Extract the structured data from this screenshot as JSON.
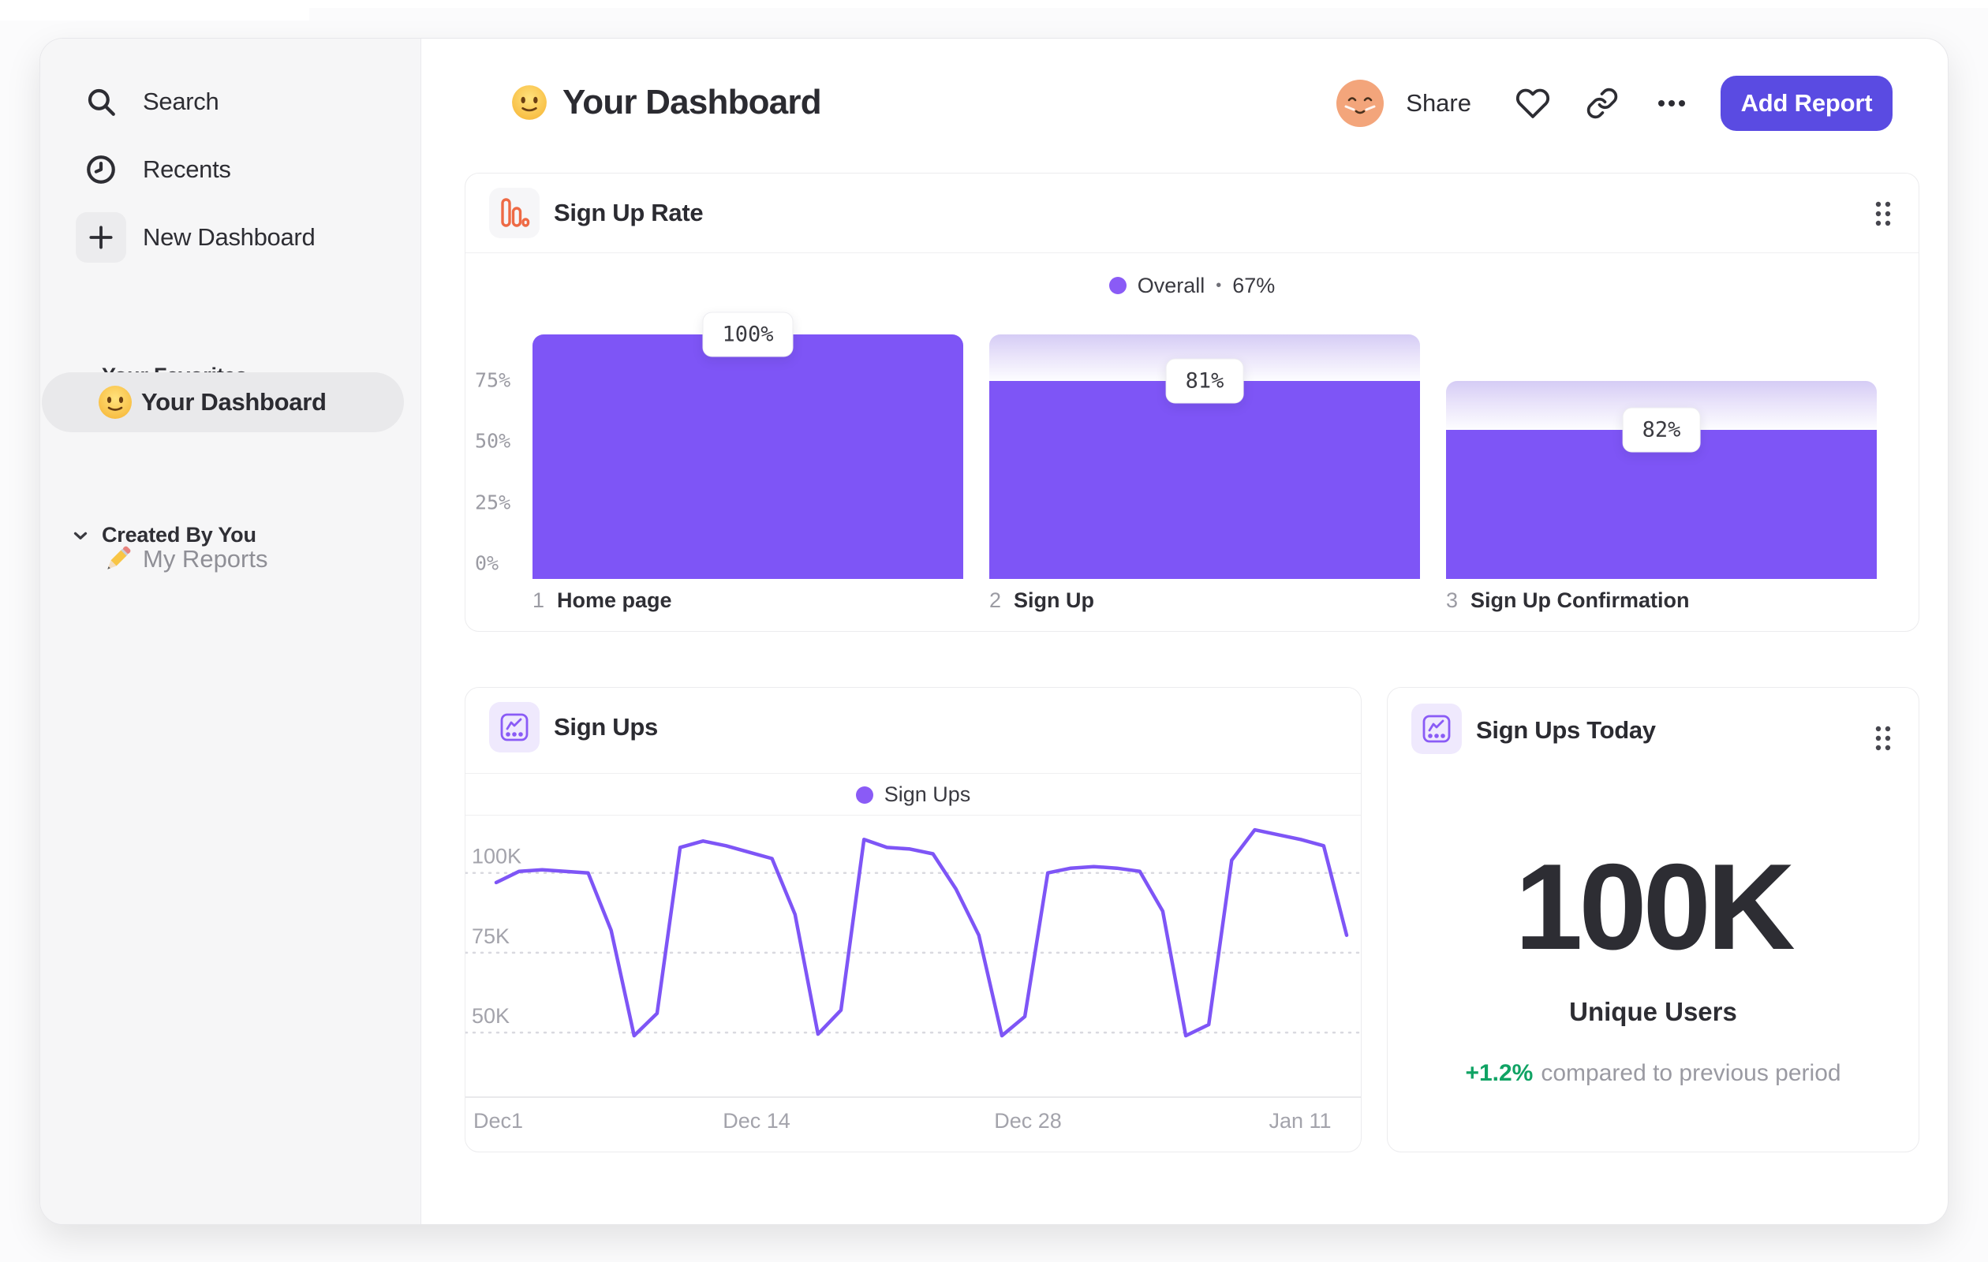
{
  "theme": {
    "accent_purple": "#7e55f6",
    "legend_purple": "#8a5bf6",
    "button_indigo": "#5a4be2",
    "icon_orange": "#ee6a45",
    "delta_green": "#10a364",
    "sidebar_bg": "#f6f6f7",
    "tick_gray": "#9b9ba3"
  },
  "sidebar": {
    "nav": [
      {
        "icon": "search-icon",
        "label": "Search"
      },
      {
        "icon": "clock-icon",
        "label": "Recents"
      },
      {
        "icon": "plus-icon",
        "label": "New Dashboard"
      }
    ],
    "sections": [
      {
        "label": "Your Favorites",
        "items": [
          {
            "icon": "smiley-emoji",
            "label": "Your Dashboard",
            "selected": true
          }
        ]
      },
      {
        "label": "Created By You",
        "items": [
          {
            "icon": "pencil-emoji",
            "label": "My Reports",
            "selected": false
          }
        ]
      }
    ]
  },
  "header": {
    "title": "Your Dashboard",
    "share": "Share",
    "add_report": "Add Report"
  },
  "funnel_card": {
    "title": "Sign Up Rate",
    "legend_label": "Overall",
    "legend_sep": "•",
    "legend_value": "67%"
  },
  "line_card": {
    "title": "Sign Ups",
    "legend_label": "Sign Ups"
  },
  "metric_card": {
    "title": "Sign Ups Today",
    "value": "100K",
    "label": "Unique Users",
    "delta": "+1.2%",
    "delta_text": "compared to previous period"
  },
  "chart_data": [
    {
      "type": "bar",
      "subtype": "funnel",
      "title": "Sign Up Rate",
      "legend": "Overall • 67%",
      "overall_conversion": "67%",
      "ylim": [
        0,
        100
      ],
      "grid": false,
      "y_ticks": [
        {
          "label": "75%",
          "value": 75
        },
        {
          "label": "50%",
          "value": 50
        },
        {
          "label": "25%",
          "value": 25
        },
        {
          "label": "0%",
          "value": 0
        }
      ],
      "steps": [
        {
          "index": "1",
          "label": "Home page",
          "conversion": "100%",
          "total_pct": 100,
          "solid_pct": 100
        },
        {
          "index": "2",
          "label": "Sign Up",
          "conversion": "81%",
          "total_pct": 100,
          "solid_pct": 81
        },
        {
          "index": "3",
          "label": "Sign Up Confirmation",
          "conversion": "82%",
          "total_pct": 81,
          "solid_pct": 61
        }
      ]
    },
    {
      "type": "line",
      "title": "Sign Ups",
      "legend": "Sign Ups",
      "ylabel": "",
      "xlabel": "",
      "y_axis": {
        "unit": "K",
        "min": 30,
        "max": 116,
        "ticks": [
          100,
          75,
          50
        ]
      },
      "x_ticks": [
        {
          "label": "Dec1",
          "px": 10,
          "align": "left"
        },
        {
          "label": "Dec 14",
          "px": 369,
          "align": "center"
        },
        {
          "label": "Dec 28",
          "px": 713,
          "align": "center"
        },
        {
          "label": "Jan 11",
          "px": 1058,
          "align": "center"
        }
      ],
      "values_k": [
        97,
        100.5,
        101,
        100.5,
        100,
        82,
        49,
        56,
        108,
        110,
        108.5,
        106.5,
        104.5,
        87,
        49.5,
        57,
        110.5,
        108,
        107.5,
        106,
        95,
        80.5,
        49,
        55,
        100,
        101.5,
        102,
        101.5,
        100.5,
        88,
        49,
        52.5,
        104,
        113.5,
        112,
        110.5,
        108.5,
        80.5
      ]
    }
  ]
}
